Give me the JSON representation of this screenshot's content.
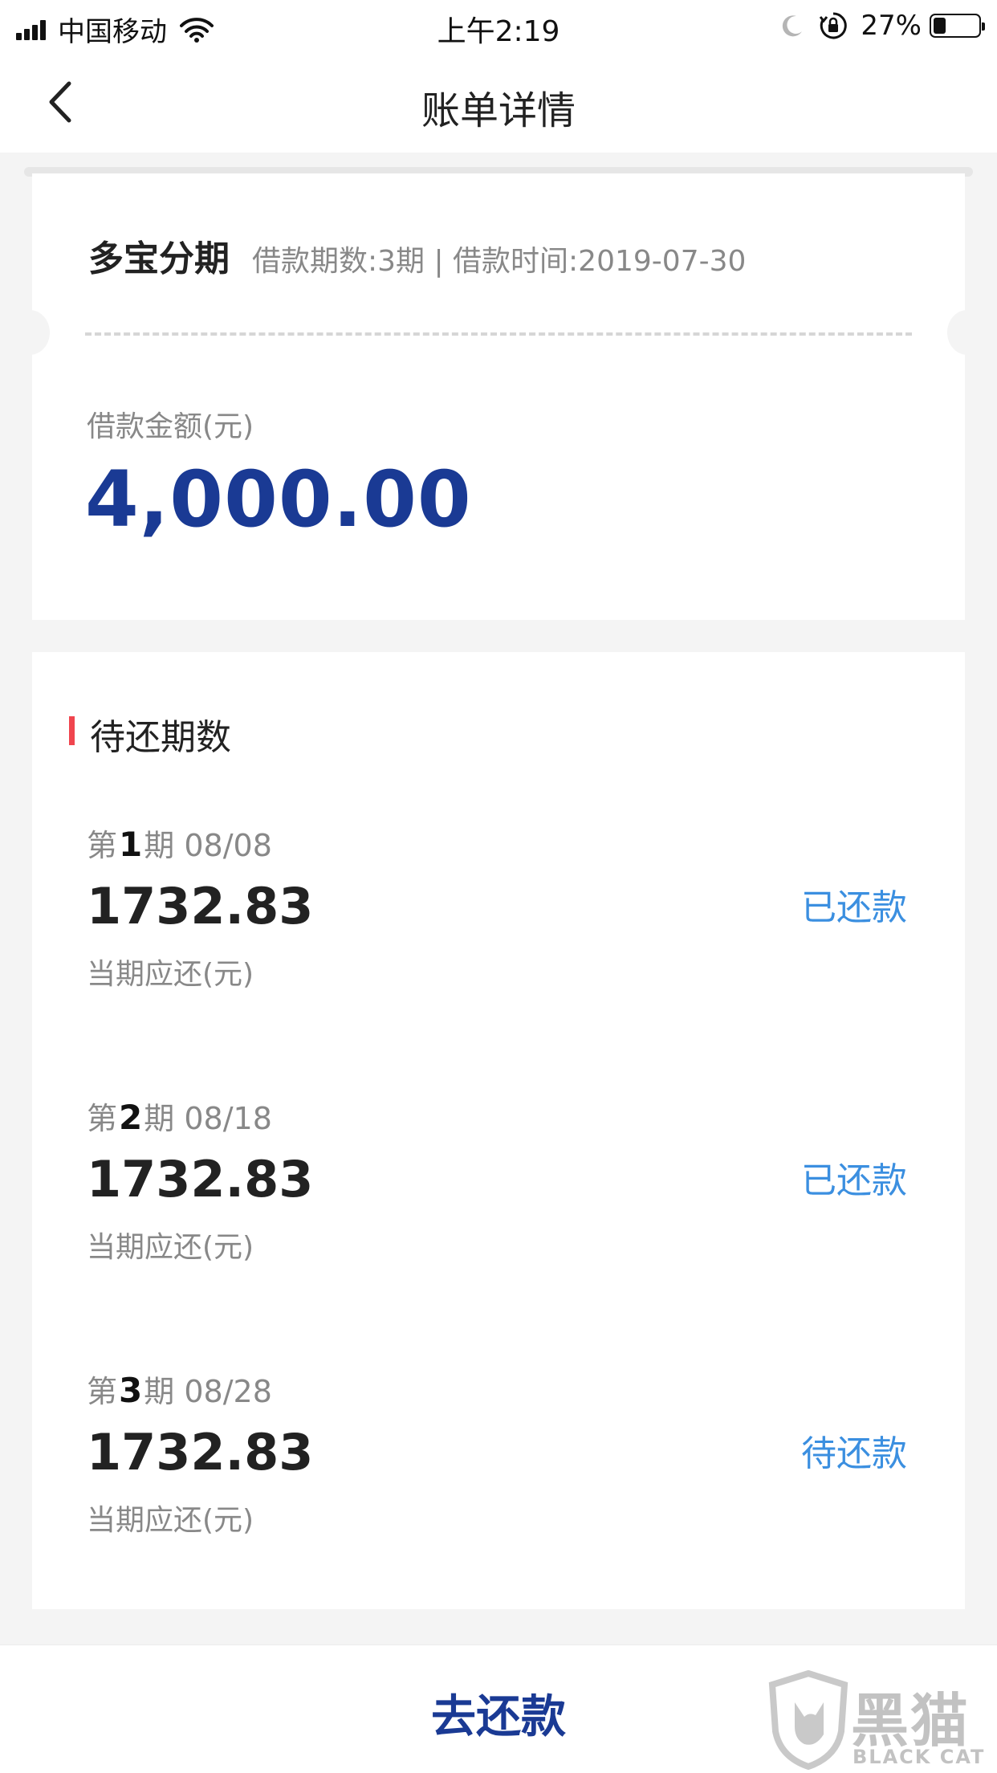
{
  "status_bar": {
    "carrier": "中国移动",
    "time": "上午2:19",
    "battery_percent": "27%",
    "battery_level": 0.27
  },
  "nav": {
    "title": "账单详情",
    "back_icon": "chevron-left-icon"
  },
  "loan": {
    "product_name": "多宝分期",
    "meta": "借款期数:3期 | 借款时间:2019-07-30",
    "amount_label": "借款金额(元)",
    "amount": "4,000.00"
  },
  "installments": {
    "section_title": "待还期数",
    "items": [
      {
        "prefix": "第",
        "number": "1",
        "suffix": "期",
        "date": "08/08",
        "amount": "1732.83",
        "sub_label": "当期应还(元)",
        "status": "已还款"
      },
      {
        "prefix": "第",
        "number": "2",
        "suffix": "期",
        "date": "08/18",
        "amount": "1732.83",
        "sub_label": "当期应还(元)",
        "status": "已还款"
      },
      {
        "prefix": "第",
        "number": "3",
        "suffix": "期",
        "date": "08/28",
        "amount": "1732.83",
        "sub_label": "当期应还(元)",
        "status": "待还款"
      }
    ]
  },
  "bottom": {
    "repay_label": "去还款"
  },
  "watermark": {
    "text": "黑猫",
    "subtext": "BLACK CAT"
  },
  "colors": {
    "accent_blue": "#1a3a94",
    "status_blue": "#3b8fe0",
    "section_red": "#f0454e"
  }
}
